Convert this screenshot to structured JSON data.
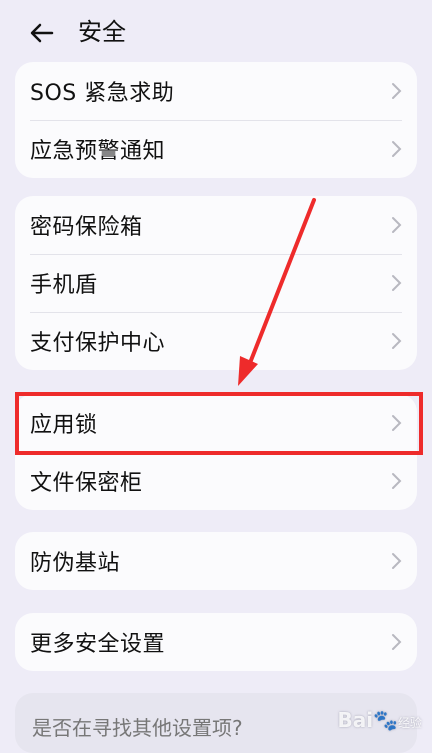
{
  "header": {
    "title": "安全"
  },
  "groups": [
    {
      "items": [
        "SOS 紧急求助",
        "应急预警通知"
      ]
    },
    {
      "items": [
        "密码保险箱",
        "手机盾",
        "支付保护中心"
      ]
    },
    {
      "items": [
        "应用锁",
        "文件保密柜"
      ]
    },
    {
      "items": [
        "防伪基站"
      ]
    },
    {
      "items": [
        "更多安全设置"
      ]
    }
  ],
  "suggestion": {
    "text": "是否在寻找其他设置项?"
  },
  "watermark": {
    "brand": "Bai",
    "suffix": "经验"
  },
  "colors": {
    "background": "#eeecf7",
    "card": "#fbfbfd",
    "highlight": "#ee2b2b",
    "chevron": "#b8b8c0"
  }
}
